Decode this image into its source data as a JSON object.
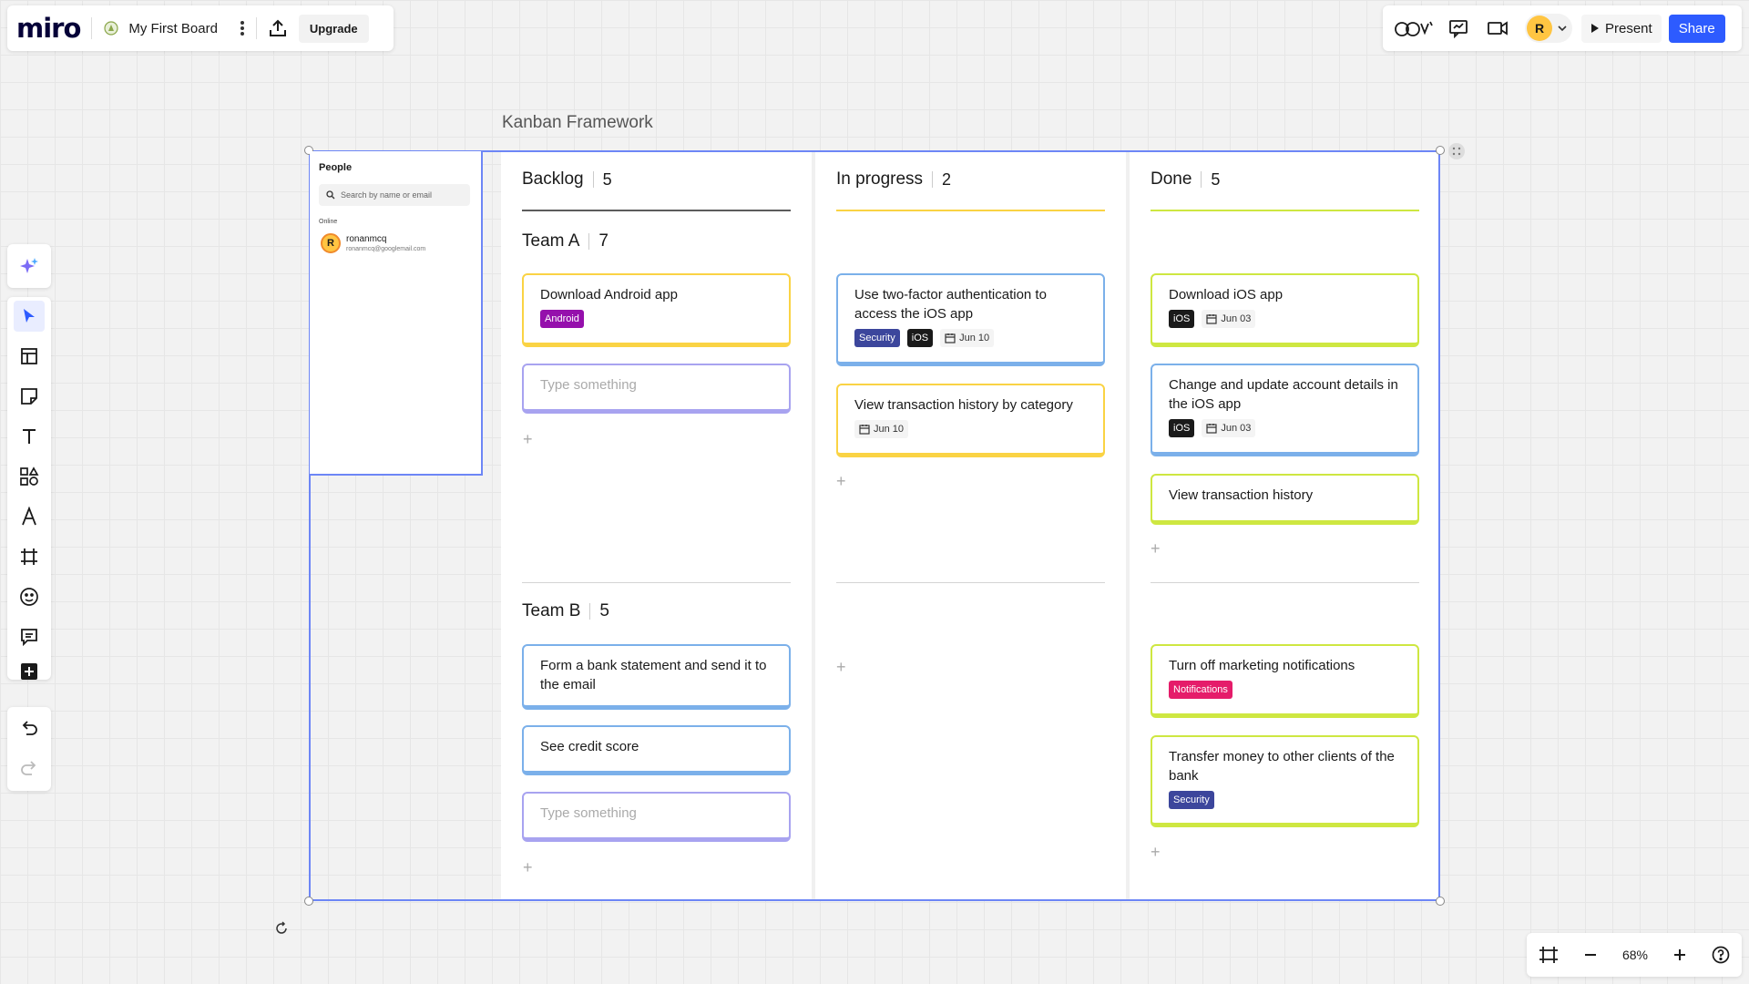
{
  "app": {
    "logo": "miro",
    "board_name": "My First Board",
    "upgrade_label": "Upgrade"
  },
  "header_right": {
    "avatar_initial": "R",
    "present_label": "Present",
    "share_label": "Share",
    "accent_color": "#2d5bff"
  },
  "zoom": {
    "level": "68%"
  },
  "frame": {
    "title": "Kanban Framework"
  },
  "people_panel": {
    "title": "People",
    "search_placeholder": "Search by name or email",
    "online_label": "Online",
    "user": {
      "initial": "R",
      "name": "ronanmcq",
      "email": "ronanmcq@googlemail.com"
    }
  },
  "columns": [
    {
      "title": "Backlog",
      "count": "5",
      "color": "#5c5c5c"
    },
    {
      "title": "In progress",
      "count": "2",
      "color": "#fad344"
    },
    {
      "title": "Done",
      "count": "5",
      "color": "#cee741"
    }
  ],
  "teams": [
    {
      "title": "Team A",
      "count": "7"
    },
    {
      "title": "Team B",
      "count": "5"
    }
  ],
  "cards": {
    "backlog_a": [
      {
        "text": "Download Android app",
        "tag": "Android"
      },
      {
        "text": "Type something"
      }
    ],
    "progress_a": [
      {
        "text": "Use two-factor authentication to access the iOS app",
        "tag1": "Security",
        "tag2": "iOS",
        "date": "Jun 10"
      },
      {
        "text": "View transaction history by category",
        "date": "Jun 10"
      }
    ],
    "done_a": [
      {
        "text": "Download iOS app",
        "tag": "iOS",
        "date": "Jun 03"
      },
      {
        "text": "Change and update account details in the iOS app",
        "tag": "iOS",
        "date": "Jun 03"
      },
      {
        "text": "View transaction history"
      }
    ],
    "backlog_b": [
      {
        "text": "Form a bank statement and send it to the email"
      },
      {
        "text": "See credit score"
      },
      {
        "text": "Type something"
      }
    ],
    "done_b": [
      {
        "text": "Turn off marketing notifications",
        "tag": "Notifications"
      },
      {
        "text": "Transfer money to other clients of the bank",
        "tag": "Security"
      }
    ]
  },
  "tag_colors": {
    "Android": "#9510ac",
    "Security": "#3c469c",
    "iOS": "#1a1a1a",
    "Notifications": "#e51c6a"
  },
  "icons": [
    "sparkle-icon",
    "cursor-icon",
    "template-icon",
    "sticky-note-icon",
    "text-icon",
    "shapes-icon",
    "pen-icon",
    "frame-icon",
    "sticker-icon",
    "comment-icon",
    "add-icon",
    "undo-icon",
    "redo-icon"
  ]
}
